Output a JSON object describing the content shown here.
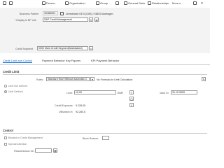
{
  "toolbar": {
    "items": [
      {
        "label": "",
        "icon": "save-icon"
      },
      {
        "label": "",
        "icon": "display-change-icon"
      },
      {
        "label": "Person",
        "icon": "person-icon"
      },
      {
        "label": "Organization",
        "icon": "organization-icon"
      },
      {
        "label": "Group",
        "icon": "group-icon"
      },
      {
        "label": "",
        "icon": "display-icon"
      },
      {
        "label": "General Data",
        "icon": "general-data-icon"
      },
      {
        "label": "Relationships",
        "icon": "relationships-icon"
      },
      {
        "label": "More",
        "icon": "chevron-down-icon"
      }
    ],
    "window_icons": [
      "maximize-icon",
      "exit-icon"
    ]
  },
  "header": {
    "business_partner_label": "Business Partner",
    "business_partner_value": "10180001",
    "business_partner_desc": "Unrestricted GE 5 (CMS) / 03803 Dambagen",
    "display_in_role_label": "* Display in BP role",
    "display_in_role_value": "SAP Credit Management",
    "credit_segment_label": "Credit Segment",
    "credit_segment_value": "0000 Main Credit Segment(Maintained)"
  },
  "tabs": [
    "Credit Limit and Control",
    "Payment Behavior Key Figures",
    "KPI Payment Behavior"
  ],
  "credit_limit": {
    "section_title": "Credit Limit",
    "rules_label": "Rules:",
    "rules_value": "Standard Rule Without Automatic C",
    "rules_desc": "No Formula for Limit Calculation",
    "limit_not_defined": "Limit Not Defined",
    "limit_defined": "Limit Defined",
    "limit_label": "Limit:",
    "limit_value": "10,00",
    "currency": "EUR",
    "valid_to_label": "Valid To:",
    "valid_to_value": "31.12.9999",
    "credit_exposure_label": "Credit Exposure:",
    "credit_exposure_value": "9.228,05",
    "utilization_label": "Utilization in:",
    "utilization_value": "92.280,5"
  },
  "control": {
    "section_title": "Control",
    "blocked_label": "Blocked in Credit Management",
    "block_reason_label": "Block Reason:",
    "special_attention_label": "Special Attention",
    "resubmission_label": "Resubmission On:"
  }
}
